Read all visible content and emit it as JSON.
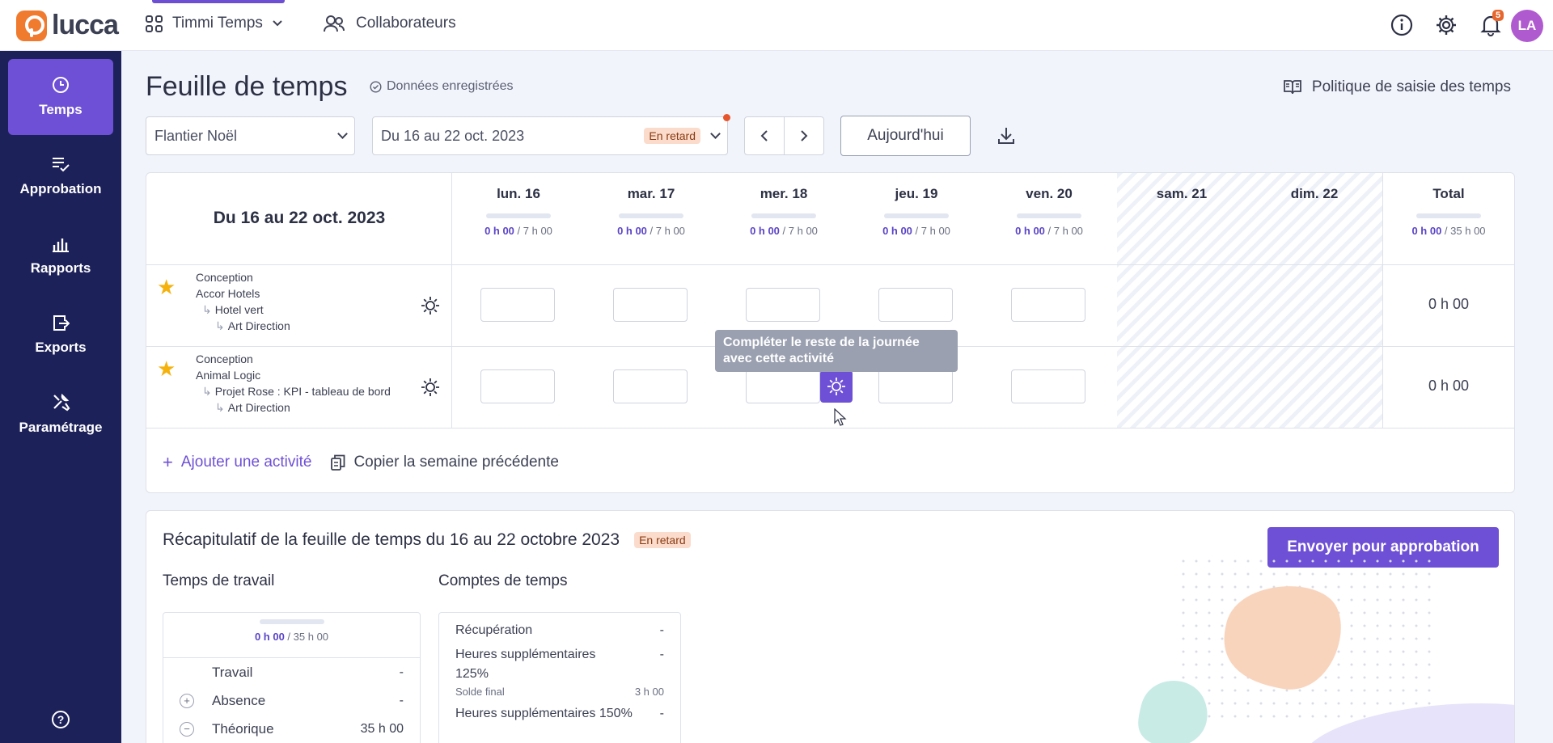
{
  "topbar": {
    "logo_text": "lucca",
    "app_name": "Timmi Temps",
    "collaborators": "Collaborateurs",
    "notif_count": "5",
    "avatar_initials": "LA"
  },
  "sidebar": {
    "items": [
      {
        "label": "Temps",
        "icon": "clock-icon"
      },
      {
        "label": "Approbation",
        "icon": "approval-icon"
      },
      {
        "label": "Rapports",
        "icon": "chart-icon"
      },
      {
        "label": "Exports",
        "icon": "export-icon"
      },
      {
        "label": "Paramétrage",
        "icon": "tools-icon"
      }
    ],
    "help": "?"
  },
  "header": {
    "title": "Feuille de temps",
    "saved_status": "Données enregistrées",
    "policy_link": "Politique de saisie des temps"
  },
  "toolbar": {
    "employee": "Flantier Noël",
    "period": "Du 16 au 22 oct. 2023",
    "period_status": "En retard",
    "today_label": "Aujourd'hui"
  },
  "sheet": {
    "week_range": "Du 16 au 22 oct. 2023",
    "days": [
      {
        "name": "lun. 16",
        "done": "0 h 00",
        "target": "7 h 00"
      },
      {
        "name": "mar. 17",
        "done": "0 h 00",
        "target": "7 h 00"
      },
      {
        "name": "mer. 18",
        "done": "0 h 00",
        "target": "7 h 00"
      },
      {
        "name": "jeu. 19",
        "done": "0 h 00",
        "target": "7 h 00"
      },
      {
        "name": "ven. 20",
        "done": "0 h 00",
        "target": "7 h 00"
      },
      {
        "name": "sam. 21",
        "done": "",
        "target": ""
      },
      {
        "name": "dim. 22",
        "done": "",
        "target": ""
      }
    ],
    "total": {
      "name": "Total",
      "done": "0 h 00",
      "target": "35 h 00"
    },
    "rows": [
      {
        "category": "Conception",
        "client": "Accor Hotels",
        "project": "Hotel vert",
        "task": "Art Direction",
        "total": "0 h 00"
      },
      {
        "category": "Conception",
        "client": "Animal Logic",
        "project": "Projet Rose : KPI - tableau de bord",
        "task": "Art Direction",
        "total": "0 h 00"
      }
    ],
    "tooltip": "Compléter le reste de la journée avec cette activité",
    "add_activity": "Ajouter une activité",
    "copy_week": "Copier la semaine précédente"
  },
  "recap": {
    "title": "Récapitulatif de la feuille de temps du 16 au 22 octobre 2023",
    "status": "En retard",
    "send_button": "Envoyer pour approbation",
    "work_time": {
      "title": "Temps de travail",
      "done": "0 h 00",
      "target": "35 h 00",
      "rows": [
        {
          "label": "Travail",
          "value": "-"
        },
        {
          "label": "Absence",
          "value": "-"
        },
        {
          "label": "Théorique",
          "value": "35 h 00"
        }
      ]
    },
    "accounts": {
      "title": "Comptes de temps",
      "rows": [
        {
          "label": "Récupération",
          "value": "-"
        },
        {
          "label": "Heures supplémentaires 125%",
          "value": "-",
          "sub_label": "Solde final",
          "sub_value": "3 h 00"
        },
        {
          "label": "Heures supplémentaires 150%",
          "value": "-"
        }
      ]
    }
  },
  "colors": {
    "brand": "#6e50d6",
    "sidebar": "#1d2159",
    "logo": "#f07a2e",
    "late": "#fbdccc"
  }
}
